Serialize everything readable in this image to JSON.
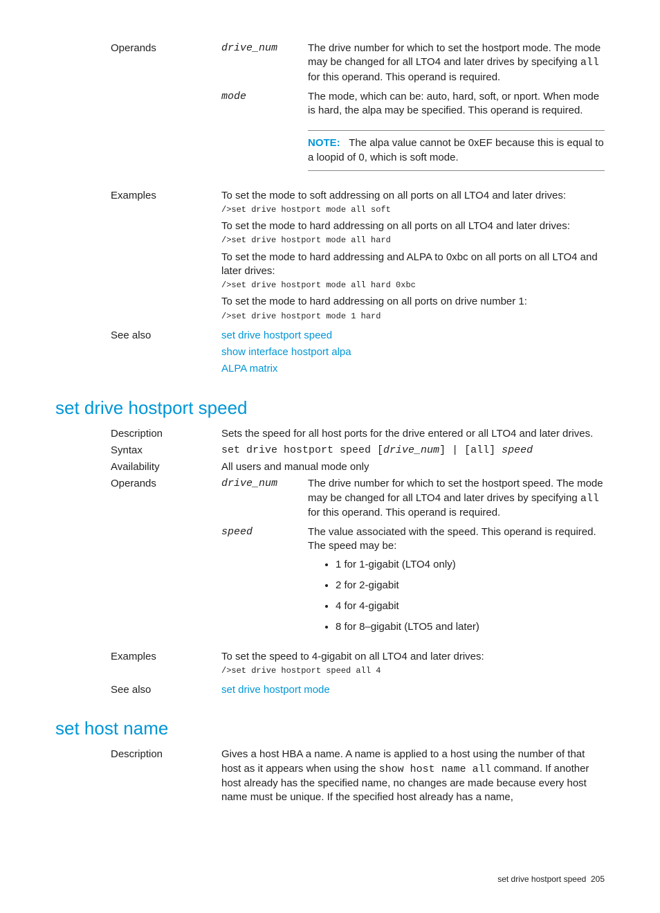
{
  "section1": {
    "operands_label": "Operands",
    "op1_name": "drive_num",
    "op1_desc_a": "The drive number for which to set the hostport mode. The mode may be changed for all LTO4 and later drives by specifying ",
    "op1_desc_code": "all",
    "op1_desc_b": " for this operand. This operand is required.",
    "op2_name": "mode",
    "op2_desc": "The mode, which can be: auto, hard, soft, or nport. When mode is hard, the alpa may be specified. This operand is required.",
    "note_label": "NOTE:",
    "note_text": "The alpa value cannot be 0xEF because this is equal to a loopid of 0, which is soft mode.",
    "examples_label": "Examples",
    "ex1_text": "To set the mode to soft addressing on all ports on all LTO4 and later drives:",
    "ex1_cmd": "/>set drive hostport mode all soft",
    "ex2_text": "To set the mode to hard addressing on all ports on all LTO4 and later drives:",
    "ex2_cmd": "/>set drive hostport mode all hard",
    "ex3_text": "To set the mode to hard addressing and ALPA to 0xbc on all ports on all LTO4 and later drives:",
    "ex3_cmd": "/>set drive hostport mode all hard 0xbc",
    "ex4_text": "To set the mode to hard addressing on all ports on drive number 1:",
    "ex4_cmd": "/>set drive hostport mode 1 hard",
    "seealso_label": "See also",
    "seealso_link1": "set drive hostport speed",
    "seealso_link2": "show interface hostport alpa",
    "seealso_link3": "ALPA matrix"
  },
  "section2": {
    "heading": "set drive hostport speed",
    "description_label": "Description",
    "description_text": "Sets the speed for all host ports for the drive entered or all LTO4 and later drives.",
    "syntax_label": "Syntax",
    "syntax_a": "set drive hostport speed  [",
    "syntax_b": "drive_num",
    "syntax_c": "]  | [all]  ",
    "syntax_d": "speed",
    "availability_label": "Availability",
    "availability_text": "All users and manual mode only",
    "operands_label": "Operands",
    "op1_name": "drive_num",
    "op1_desc_a": "The drive number for which to set the hostport speed. The mode may be changed for all LTO4 and later drives by specifying ",
    "op1_desc_code": "all",
    "op1_desc_b": " for this operand. This operand is required.",
    "op2_name": "speed",
    "op2_desc": "The value associated with the speed. This operand is required. The speed may be:",
    "speed1": "1 for 1-gigabit (LTO4 only)",
    "speed2": "2 for 2-gigabit",
    "speed3": "4 for 4-gigabit",
    "speed4": "8 for 8–gigabit (LTO5 and later)",
    "examples_label": "Examples",
    "ex1_text": "To set the speed to 4-gigabit on all LTO4 and later drives:",
    "ex1_cmd": "/>set drive hostport speed all 4",
    "seealso_label": "See also",
    "seealso_link1": "set drive hostport mode"
  },
  "section3": {
    "heading": "set host name",
    "description_label": "Description",
    "description_text_a": "Gives a host HBA a name. A name is applied to a host using the number of that host as it appears when using the ",
    "description_code": "show host name all",
    "description_text_b": " command. If another host already has the specified name, no changes are made because every host name must be unique. If the specified host already has a name,"
  },
  "footer": {
    "text": "set drive hostport speed",
    "page": "205"
  }
}
